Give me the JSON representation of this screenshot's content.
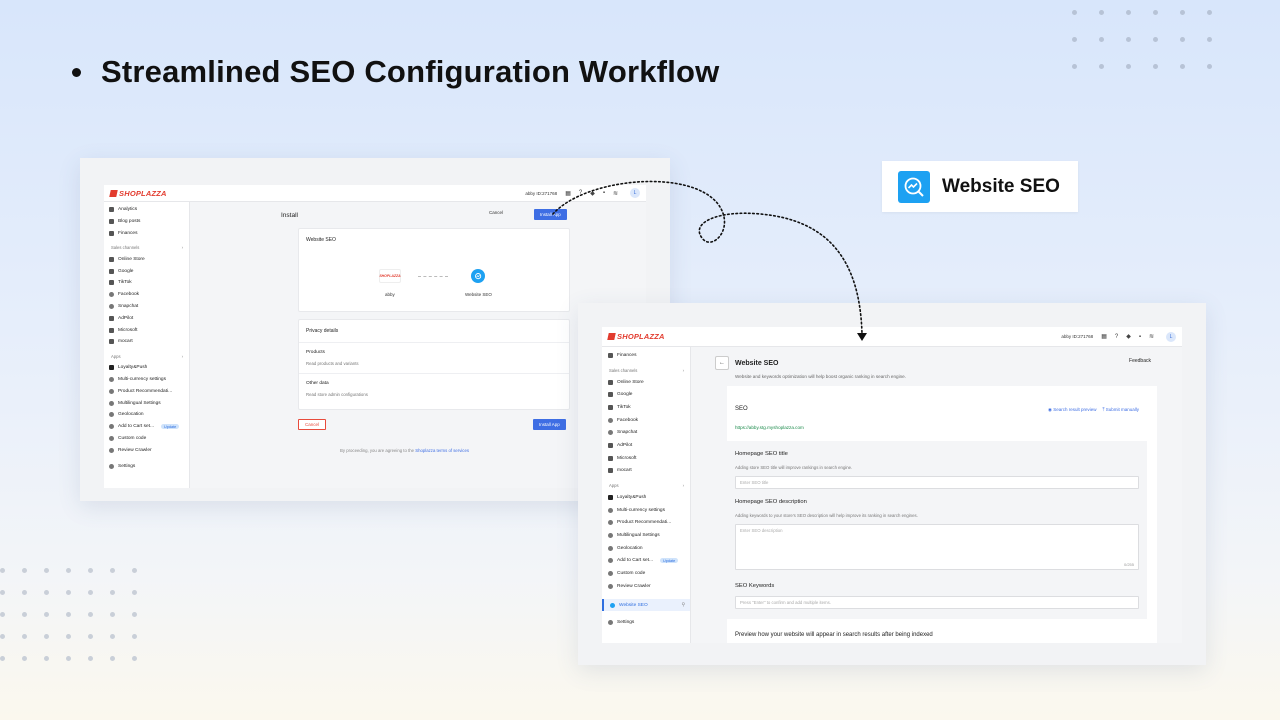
{
  "slide": {
    "headline": "Streamlined SEO Configuration Workflow",
    "badge_label": "Website SEO"
  },
  "colors": {
    "brand_red": "#e23b2e",
    "primary_blue": "#3e6ee4",
    "app_icon_blue": "#1da1f2",
    "url_green": "#1a8a4a"
  },
  "install_window": {
    "logo": "SHOPLAZZA",
    "store_label": "abby ID:271768",
    "avatar": "L",
    "sidebar": {
      "top_items": [
        "Analytics",
        "Blog posts",
        "Finances"
      ],
      "sales_channels_label": "Sales channels",
      "channels": [
        "Online Store",
        "Google",
        "TikTok",
        "Facebook",
        "Snapchat",
        "AdPilot",
        "Microsoft",
        "mocart"
      ],
      "apps_label": "Apps",
      "apps": [
        "Loyalty&Push",
        "Multi-currency settings",
        "Product Recommendati...",
        "Multilingual Settings",
        "Geolocation",
        "Add to Cart set...",
        "Custom code",
        "Review Crawler"
      ],
      "update_badge": "Update",
      "settings": "Settings"
    },
    "page_title": "Install",
    "cancel_label": "Cancel",
    "install_label": "Install App",
    "app_card_title": "Website SEO",
    "store_name": "abby",
    "app_name": "Website SEO",
    "connect_logo": "SHOPLAZZA",
    "privacy_title": "Privacy details",
    "products_title": "Products",
    "products_desc": "Read products and variants",
    "other_title": "Other data",
    "other_desc": "Read store admin configurations",
    "bottom_cancel": "Cancel",
    "bottom_install": "Install App",
    "terms_prefix": "By proceeding, you are agreeing to the",
    "terms_link": "Shoplazza terms of services"
  },
  "seo_window": {
    "logo": "SHOPLAZZA",
    "store_label": "abby ID:271768",
    "avatar": "L",
    "sidebar": {
      "top_items": [
        "Finances"
      ],
      "sales_channels_label": "Sales channels",
      "channels": [
        "Online Store",
        "Google",
        "TikTok",
        "Facebook",
        "Snapchat",
        "AdPilot",
        "Microsoft",
        "mocart"
      ],
      "apps_label": "Apps",
      "apps": [
        "Loyalty&Push",
        "Multi-currency settings",
        "Product Recommendati...",
        "Multilingual Settings",
        "Geolocation",
        "Add to Cart set...",
        "Custom code",
        "Review Crawler"
      ],
      "update_badge": "Update",
      "active_item": "Website SEO",
      "settings": "Settings"
    },
    "title": "Website SEO",
    "subtitle": "Website and keywords optimization will help boost organic ranking in search engine.",
    "feedback": "Feedback",
    "seo_label": "SEO",
    "search_preview": "Search result preview",
    "submit_manually": "Submit manually",
    "url": "https://abby.stg.myshoplazza.com",
    "homepage_title_label": "Homepage SEO title",
    "homepage_title_help": "Adding store SEO title will improve rankings in search engine.",
    "homepage_title_placeholder": "Enter SEO title",
    "homepage_desc_label": "Homepage SEO description",
    "homepage_desc_help": "Adding keywords to your store's SEO description will help improve its ranking in search engines.",
    "homepage_desc_placeholder": "Enter SEO description",
    "desc_counter": "0/255",
    "keywords_label": "SEO Keywords",
    "keywords_placeholder": "Press \"Enter\" to confirm and add multiple items.",
    "preview_text": "Preview how your website will appear in search results after being indexed"
  }
}
